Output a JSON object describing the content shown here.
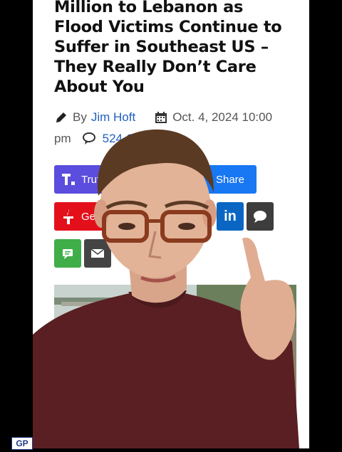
{
  "article": {
    "headline_lines": [
      "Million to Lebanon as",
      "Flood Victims Continue to",
      "Suffer in Southeast US –",
      "They Really Don’t Care",
      "About You"
    ],
    "byline_prefix": "By",
    "author": "Jim Hoft",
    "date": "Oct. 4, 2024 10:00",
    "time_suffix": "pm",
    "comments": "524 Comments"
  },
  "share_buttons": {
    "truth_label": "Truth",
    "share_label": "Share",
    "gettr_label": "Get"
  },
  "badge_text": "GP",
  "icons": {
    "author": "pencil-icon",
    "date": "calendar-icon",
    "comments": "comments-icon",
    "truth": "truth-social-icon",
    "gettr": "gettr-icon",
    "linkedin": "linkedin-icon",
    "comment": "speech-bubble-icon",
    "sms": "sms-icon",
    "email": "email-icon"
  },
  "colors": {
    "truth": "#5b4ddd",
    "share": "#1877f2",
    "gettr": "#e3101b",
    "linkedin": "#0a66c2",
    "sms": "#3fae49",
    "link": "#1f5fbf"
  }
}
